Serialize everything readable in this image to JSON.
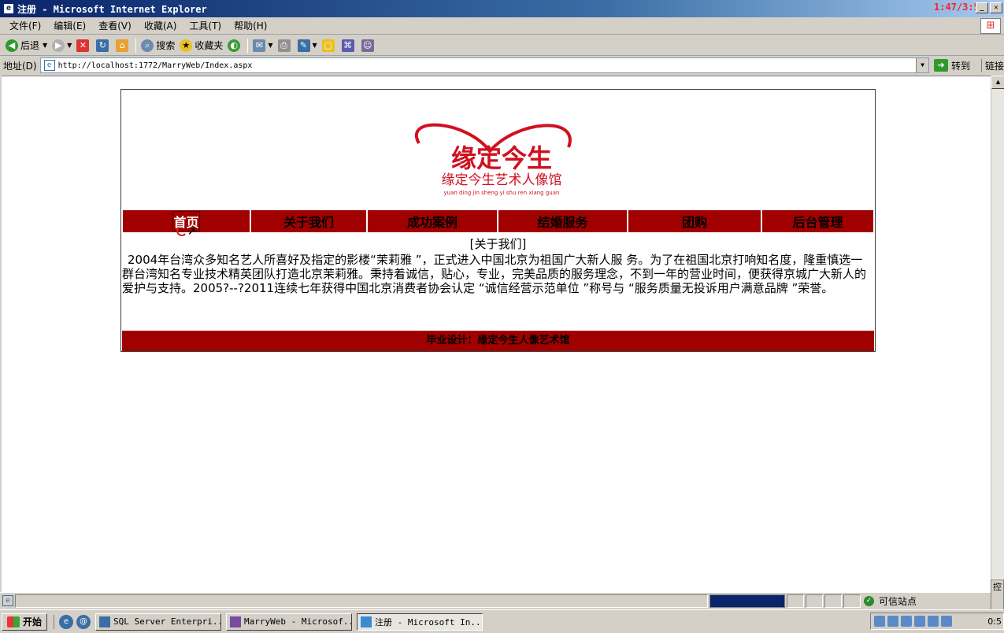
{
  "window": {
    "title": "注册 - Microsoft Internet Explorer",
    "clock": "1:47/3:50"
  },
  "menu": [
    "文件(F)",
    "编辑(E)",
    "查看(V)",
    "收藏(A)",
    "工具(T)",
    "帮助(H)"
  ],
  "toolbar": {
    "back_label": "后退",
    "search_label": "搜索",
    "favorites_label": "收藏夹"
  },
  "address": {
    "label": "地址(D)",
    "url": "http://localhost:1772/MarryWeb/Index.aspx",
    "go_label": "转到",
    "links_label": "链接"
  },
  "site": {
    "logo_title": "缘定今生",
    "logo_subtitle": "缘定今生艺术人像馆",
    "logo_pinyin": "yuan ding jin sheng yi shu ren xiang guan",
    "nav": [
      "首页",
      "关于我们",
      "成功案例",
      "结婚服务",
      "团购",
      "后台管理"
    ],
    "section_heading": "[关于我们]",
    "body": "2004年台湾众多知名艺人所喜好及指定的影楼“茉莉雅 ”，正式进入中国北京为祖国广大新人服 务。为了在祖国北京打响知名度，隆重慎选一群台湾知名专业技术精英团队打造北京茉莉雅。秉持着诚信，贴心，专业，完美品质的服务理念，不到一年的营业时间，便获得京城广大新人的爱护与支持。2005?--?2011连续七年获得中国北京消费者协会认定 “诚信经营示范单位 ”称号与 “服务质量无投诉用户满意品牌 ”荣誉。",
    "footer": "毕业设计：缘定今生人像艺术馆",
    "brand_color": "#a00000"
  },
  "status": {
    "zone": "可信站点"
  },
  "taskbar": {
    "start_label": "开始",
    "tasks": [
      "SQL Server Enterpri...",
      "MarryWeb - Microsof...",
      "注册 - Microsoft In..."
    ],
    "time": "0:5"
  }
}
